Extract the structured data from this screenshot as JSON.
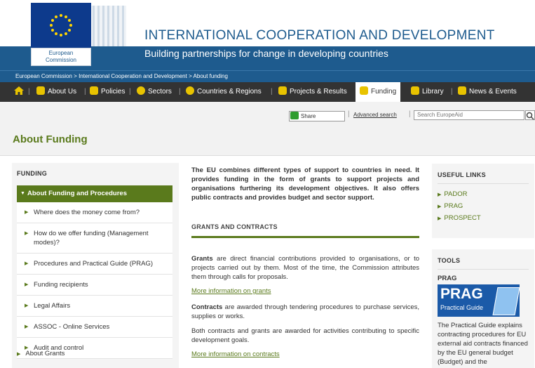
{
  "header": {
    "logo_line1": "European",
    "logo_line2": "Commission",
    "title": "INTERNATIONAL COOPERATION AND DEVELOPMENT",
    "subtitle": "Building partnerships for change in developing countries"
  },
  "breadcrumb": [
    "European Commission",
    "International Cooperation and Development",
    "About funding"
  ],
  "breadcrumb_separator": ">",
  "nav": {
    "items": [
      {
        "label": "About Us",
        "icon": "info-icon"
      },
      {
        "label": "Policies",
        "icon": "policy-icon"
      },
      {
        "label": "Sectors",
        "icon": "gear-icon"
      },
      {
        "label": "Countries & Regions",
        "icon": "globe-icon"
      },
      {
        "label": "Projects & Results",
        "icon": "chart-icon"
      },
      {
        "label": "Funding",
        "icon": "funding-icon"
      },
      {
        "label": "Library",
        "icon": "library-icon"
      },
      {
        "label": "News & Events",
        "icon": "news-icon"
      }
    ],
    "active": "Funding"
  },
  "toolbar": {
    "share_label": "Share",
    "advanced_search": "Advanced search",
    "search_placeholder": "Search EuropeAid"
  },
  "page_title": "About Funding",
  "left_sidebar": {
    "heading": "FUNDING",
    "active_item": "About Funding and Procedures",
    "items": [
      "Where does the money come from?",
      "How do we offer funding (Management modes)?",
      "Procedures and Practical Guide (PRAG)",
      "Funding recipients",
      "Legal Affairs",
      "ASSOC - Online Services",
      "Audit and control"
    ],
    "bottom_item": "About Grants"
  },
  "main": {
    "intro": "The EU combines different types of support to countries in need. It provides funding in the form of grants to support projects and organisations furthering its development objectives. It also offers public contracts and provides budget and sector support.",
    "section_heading": "GRANTS AND CONTRACTS",
    "grants_bold": "Grants",
    "grants_text": " are direct financial contributions provided to organisations, or to projects carried out by them. Most of the time, the Commission attributes them through calls for proposals.",
    "grants_link": "More information on grants",
    "contracts_bold": "Contracts",
    "contracts_text": " are awarded through tendering procedures to purchase services, supplies or works.",
    "both_text": "Both contracts and grants are awarded for activities contributing to specific development goals.",
    "contracts_link": "More information on contracts"
  },
  "useful_links": {
    "heading": "USEFUL LINKS",
    "items": [
      "PADOR",
      "PRAG",
      "PROSPECT"
    ]
  },
  "tools": {
    "heading": "TOOLS",
    "subheading": "PRAG",
    "image_title": "PRAG",
    "image_subtitle": "Practical Guide",
    "description": "The Practical Guide explains contracting procedures for EU external aid contracts financed by the EU general budget (Budget) and the"
  },
  "colors": {
    "brand_blue": "#1e5b8e",
    "accent_green": "#5a7a1c",
    "nav_dark": "#333333"
  }
}
